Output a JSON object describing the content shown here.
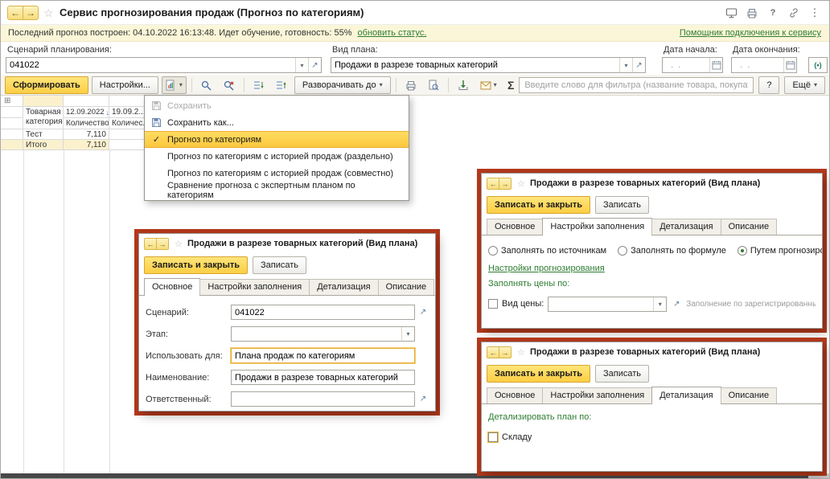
{
  "window": {
    "title": "Сервис прогнозирования продаж (Прогноз по категориям)"
  },
  "icons": {
    "back": "←",
    "forward": "→",
    "star": "☆",
    "caret": "▾",
    "open_field": "↗",
    "expand_all": "⊞",
    "check": "✓",
    "kebab": "⋮",
    "sort_desc": "↓",
    "header_menu": "≡",
    "period": "(•)"
  },
  "status_bar": {
    "message": "Последний прогноз построен: 04.10.2022 16:13:48. Идет обучение, готовность: 55%",
    "refresh_link": "обновить статус.",
    "assistant_link": "Помощник подключения к сервису"
  },
  "filters": {
    "scenario_label": "Сценарий планирования:",
    "scenario_value": "041022",
    "plan_label": "Вид плана:",
    "plan_value": "Продажи в разрезе товарных категорий",
    "date_start_label": "Дата начала:",
    "date_start_value": "  .  .",
    "date_end_label": "Дата окончания:",
    "date_end_value": "  .  ."
  },
  "toolbar": {
    "generate_label": "Сформировать",
    "settings_label": "Настройки...",
    "expand_to_label": "Разворачивать до",
    "sigma_label": "Σ",
    "filter_placeholder": "Введите слово для фильтра (название товара, покупателя и пр.)",
    "help_label": "?",
    "more_label": "Ещё"
  },
  "variant_menu": {
    "items": [
      {
        "label": "Сохранить"
      },
      {
        "label": "Сохранить как..."
      },
      {
        "label": "Прогноз по категориям"
      },
      {
        "label": "Прогноз по категориям с историей продаж (раздельно)"
      },
      {
        "label": "Прогноз по категориям с историей продаж (совместно)"
      },
      {
        "label": "Сравнение прогноза с экспертным планом по категориям"
      }
    ]
  },
  "table": {
    "category_header": "Товарная категория",
    "period1_header": "12.09.2022",
    "period1_subheader": "Количество",
    "period2_header": "19.09.2...",
    "period2_subheader": "Количес...",
    "rows": [
      {
        "category": "Тест",
        "quantity": "7,110"
      },
      {
        "category": "Итого",
        "quantity": "7,110"
      }
    ]
  },
  "dialog_common": {
    "title": "Продажи в разрезе товарных категорий (Вид плана)",
    "save_close_label": "Записать и закрыть",
    "save_label": "Записать",
    "tabs": [
      "Основное",
      "Настройки заполнения",
      "Детализация",
      "Описание"
    ]
  },
  "dialog_main": {
    "fields": [
      {
        "label": "Сценарий:",
        "value": "041022"
      },
      {
        "label": "Этап:",
        "value": ""
      },
      {
        "label": "Использовать для:",
        "value": "Плана продаж по категориям"
      },
      {
        "label": "Наименование:",
        "value": "Продажи в разрезе товарных категорий"
      },
      {
        "label": "Ответственный:",
        "value": ""
      }
    ]
  },
  "dialog_fill": {
    "radio_sources_label": "Заполнять по источникам",
    "radio_formula_label": "Заполнять по формуле",
    "radio_forecast_label": "Путем прогнозирования",
    "forecast_settings_link": "Настройки прогнозирования",
    "prices_group_label": "Заполнять цены по:",
    "price_kind_label": "Вид цены:",
    "price_kind_value": "",
    "price_hint": "Заполнение по зарегистрированным ценам компании."
  },
  "dialog_detail": {
    "group_label": "Детализировать план по:",
    "warehouse_label": "Складу"
  }
}
